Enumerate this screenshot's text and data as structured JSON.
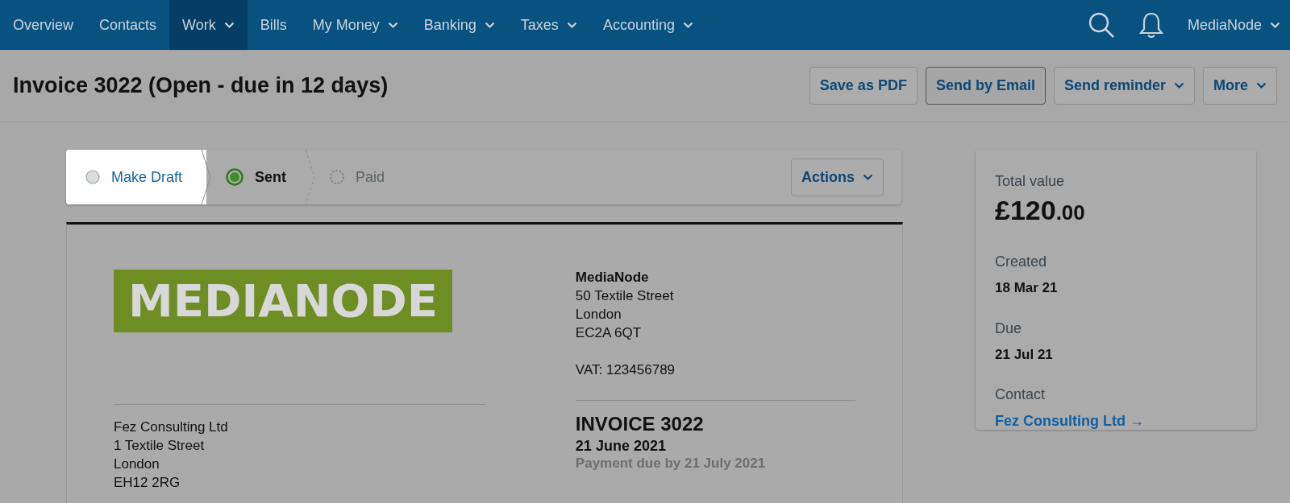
{
  "nav": {
    "items": [
      {
        "label": "Overview",
        "selected": false,
        "dropdown": false
      },
      {
        "label": "Contacts",
        "selected": false,
        "dropdown": false
      },
      {
        "label": "Work",
        "selected": true,
        "dropdown": true
      },
      {
        "label": "Bills",
        "selected": false,
        "dropdown": false
      },
      {
        "label": "My Money",
        "selected": false,
        "dropdown": true
      },
      {
        "label": "Banking",
        "selected": false,
        "dropdown": true
      },
      {
        "label": "Taxes",
        "selected": false,
        "dropdown": true
      },
      {
        "label": "Accounting",
        "selected": false,
        "dropdown": true
      }
    ],
    "account": "MediaNode"
  },
  "header": {
    "title": "Invoice 3022 (Open - due in 12 days)",
    "buttons": [
      {
        "label": "Save as PDF",
        "dropdown": false,
        "emphasized": false
      },
      {
        "label": "Send by Email",
        "dropdown": false,
        "emphasized": true
      },
      {
        "label": "Send reminder",
        "dropdown": true,
        "emphasized": false
      },
      {
        "label": "More",
        "dropdown": true,
        "emphasized": false
      }
    ]
  },
  "stepper": {
    "steps": [
      {
        "label": "Make Draft",
        "kind": "link",
        "highlighted": true
      },
      {
        "label": "Sent",
        "kind": "current",
        "highlighted": false
      },
      {
        "label": "Paid",
        "kind": "pending",
        "highlighted": false
      }
    ],
    "actions": "Actions"
  },
  "invoice": {
    "logo": "MEDIANODE",
    "sender": {
      "name": "MediaNode",
      "lines": [
        "50 Textile Street",
        "London",
        "EC2A 6QT"
      ],
      "vat": "VAT: 123456789"
    },
    "recipient": {
      "lines": [
        "Fez Consulting Ltd",
        "1 Textile Street",
        "London",
        "EH12 2RG"
      ]
    },
    "title": "INVOICE 3022",
    "date": "21 June 2021",
    "due": "Payment due by 21 July 2021"
  },
  "summary": {
    "total_label": "Total value",
    "amount_main": "£120",
    "amount_cents": ".00",
    "fields": [
      {
        "label": "Created",
        "value": "18 Mar 21",
        "kind": "text"
      },
      {
        "label": "Due",
        "value": "21 Jul 21",
        "kind": "text"
      },
      {
        "label": "Contact",
        "value": "Fez Consulting Ltd →",
        "kind": "link"
      }
    ]
  }
}
